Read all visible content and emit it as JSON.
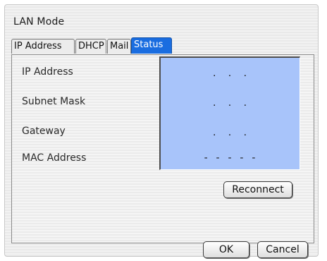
{
  "window": {
    "title": "LAN Mode"
  },
  "tabs": [
    {
      "label": "IP Address",
      "active": false
    },
    {
      "label": "DHCP",
      "active": false
    },
    {
      "label": "Mail",
      "active": false
    },
    {
      "label": "Status",
      "active": true
    }
  ],
  "status": {
    "labels": {
      "ip_address": "IP Address",
      "subnet_mask": "Subnet Mask",
      "gateway": "Gateway",
      "mac_address": "MAC Address"
    },
    "values": {
      "ip_address": ".   .   .",
      "subnet_mask": ".   .   .",
      "gateway": ".   .   .",
      "mac_address": "-  -  -  -  -"
    },
    "box_color": "#a8c4fa",
    "reconnect_label": "Reconnect"
  },
  "footer": {
    "ok_label": "OK",
    "cancel_label": "Cancel"
  },
  "colors": {
    "active_tab": "#1a6de0"
  }
}
